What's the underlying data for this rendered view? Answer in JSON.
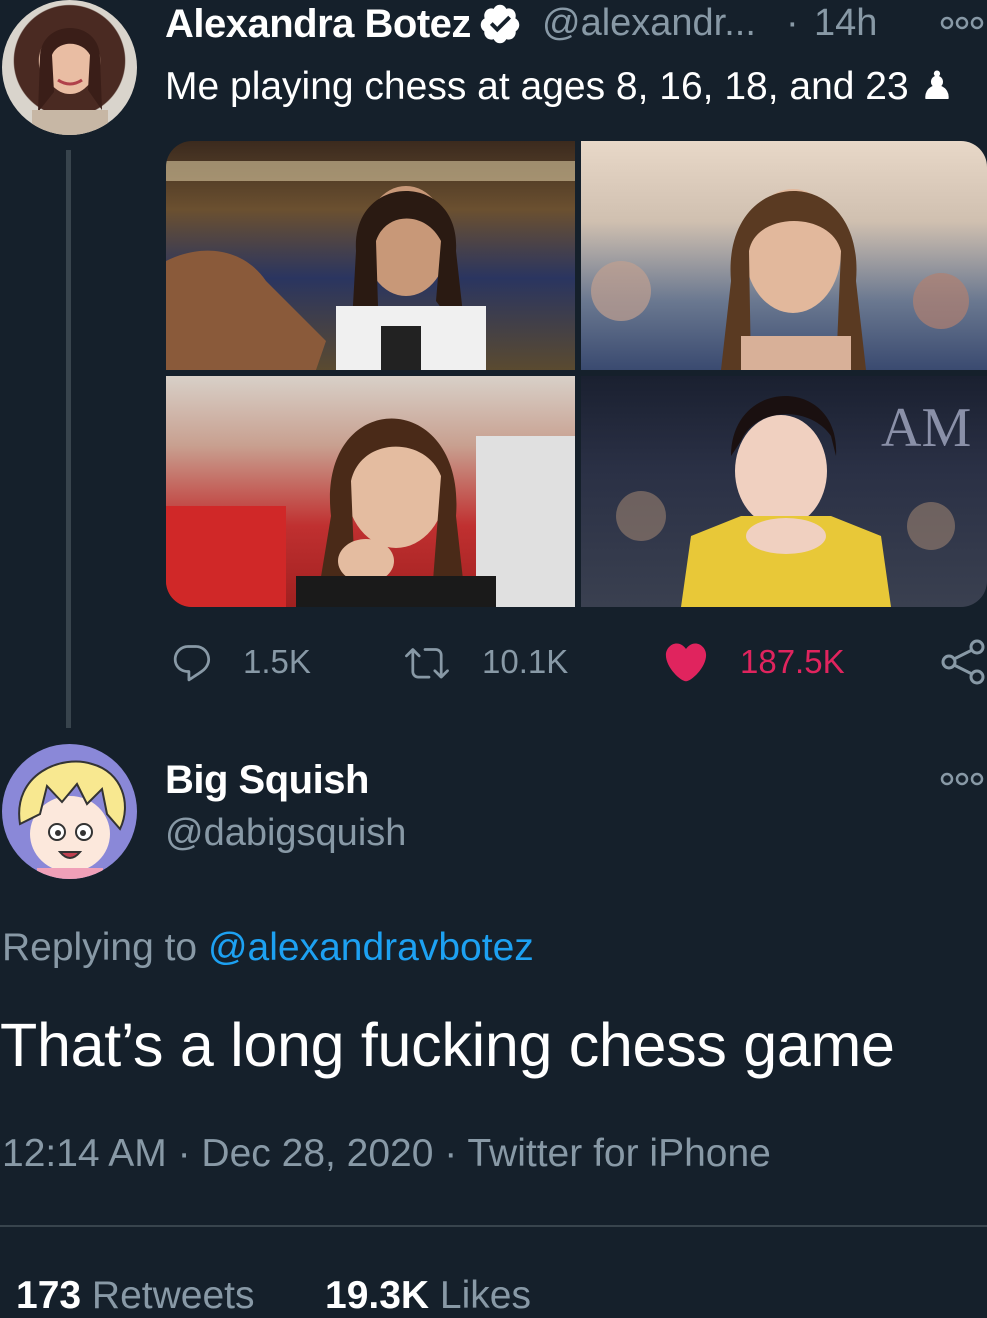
{
  "original_tweet": {
    "author_name": "Alexandra Botez",
    "handle": "@alexandr...",
    "separator": "·",
    "time_ago": "14h",
    "text": "Me playing chess at ages 8, 16, 18, and 23 ♟",
    "replies": "1.5K",
    "retweets": "10.1K",
    "likes": "187.5K",
    "verified": true,
    "liked": true
  },
  "reply_tweet": {
    "author_name": "Big Squish",
    "handle": "@dabigsquish",
    "replying_label": "Replying to",
    "replying_handle": "@alexandravbotez",
    "text": "That’s a long fucking chess game",
    "timestamp": "12:14 AM · Dec 28, 2020 · Twitter for iPhone",
    "retweet_count": "173",
    "retweet_label": "Retweets",
    "like_count": "19.3K",
    "like_label": "Likes"
  },
  "colors": {
    "background": "#15202b",
    "muted": "#8899a6",
    "link": "#1da1f2",
    "like": "#e0245e"
  },
  "icons": [
    "verified-badge-icon",
    "more-options-icon",
    "reply-icon",
    "retweet-icon",
    "like-heart-icon",
    "share-icon",
    "chess-pawn-icon"
  ]
}
